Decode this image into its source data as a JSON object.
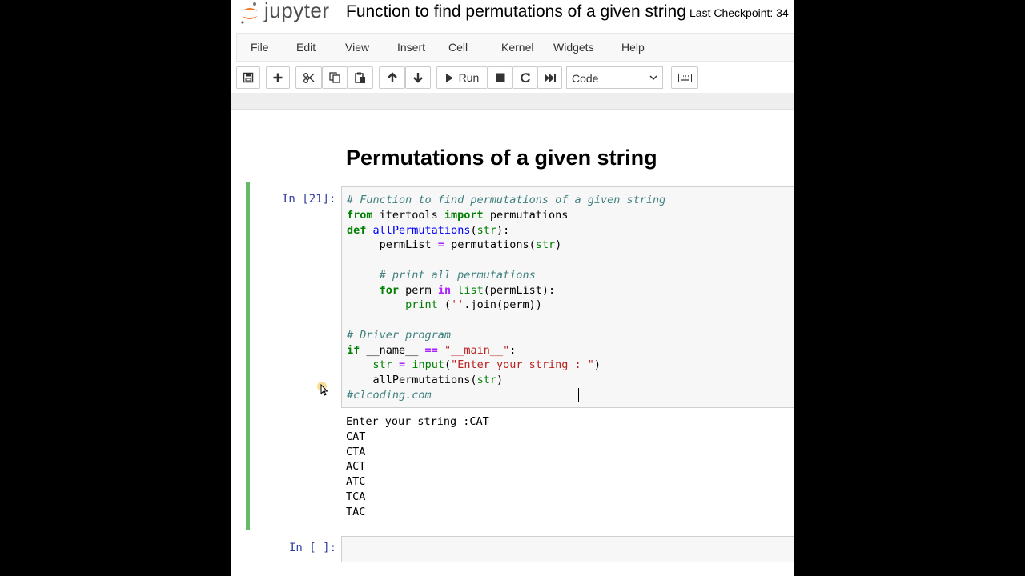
{
  "header": {
    "logo_text": "jupyter",
    "notebook_title": "Function to find permutations of a given string",
    "checkpoint": "Last Checkpoint: 34"
  },
  "menu": [
    "File",
    "Edit",
    "View",
    "Insert",
    "Cell",
    "Kernel",
    "Widgets",
    "Help"
  ],
  "toolbar": {
    "run_label": "Run",
    "cell_type": "Code",
    "icons": [
      "save-icon",
      "plus-icon",
      "cut-icon",
      "copy-icon",
      "paste-icon",
      "arrow-up-icon",
      "arrow-down-icon",
      "play-icon",
      "stop-icon",
      "restart-icon",
      "fast-forward-icon",
      "keyboard-icon"
    ]
  },
  "notebook": {
    "heading": "Permutations of a given string",
    "cell1": {
      "prompt": "In [21]:",
      "code_lines": [
        "# Function to find permutations of a given string",
        "from itertools import permutations",
        "def allPermutations(str):",
        "     permList = permutations(str)",
        "",
        "     # print all permutations",
        "     for perm in list(permList):",
        "         print (''.join(perm))",
        "",
        "# Driver program",
        "if __name__ == \"__main__\":",
        "    str = input(\"Enter your string : \")",
        "    allPermutations(str)",
        "#clcoding.com"
      ],
      "output_lines": [
        "Enter your string :CAT",
        "CAT",
        "CTA",
        "ACT",
        "ATC",
        "TCA",
        "TAC"
      ]
    },
    "cell2": {
      "prompt": "In [ ]:"
    }
  },
  "colors": {
    "selected_cell_border": "#66bb6a",
    "prompt": "#303f9f",
    "comment": "#408080",
    "keyword": "#008000",
    "string": "#ba2121"
  }
}
